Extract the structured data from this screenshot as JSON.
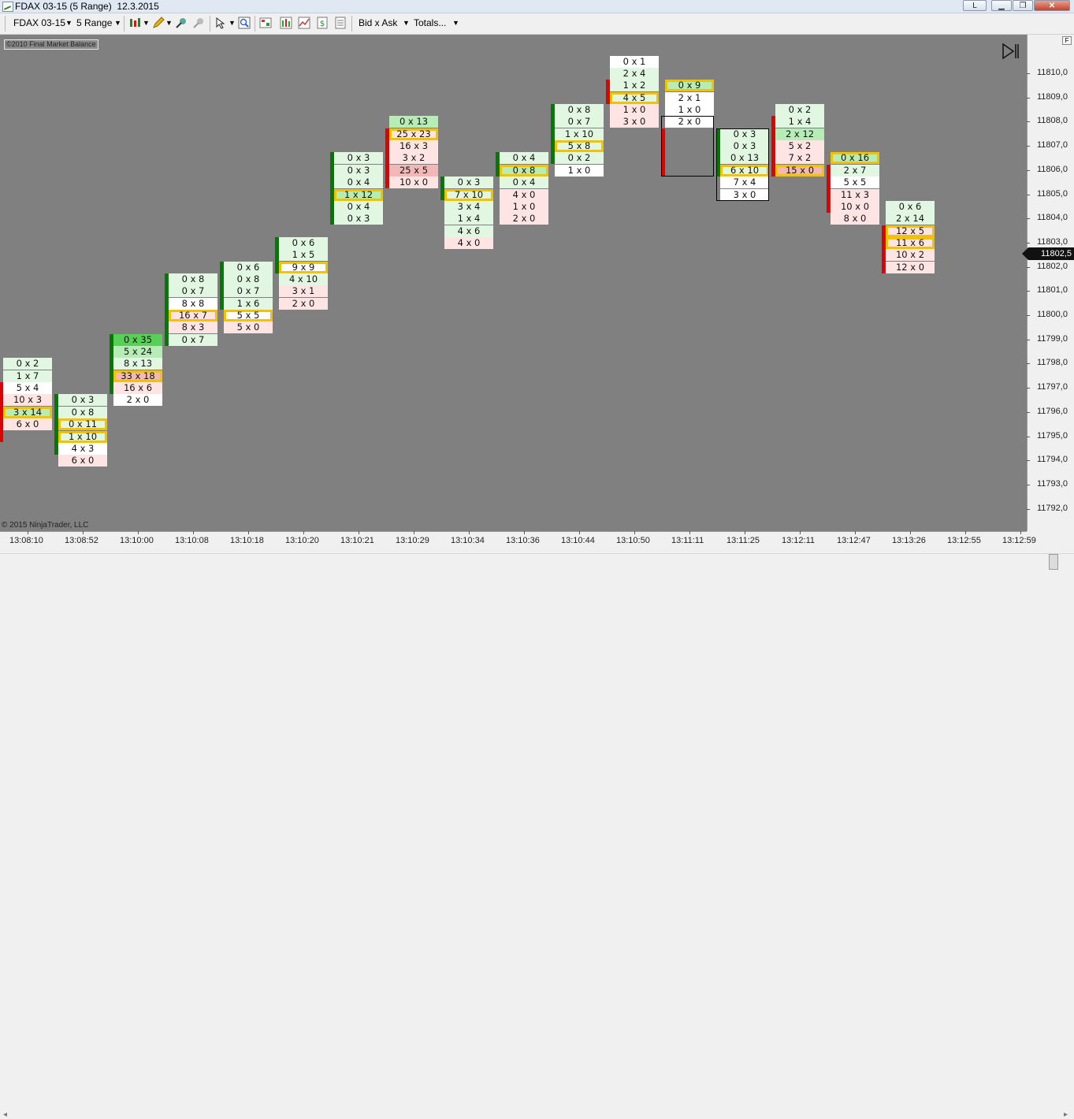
{
  "window": {
    "title": "FDAX 03-15 (5 Range)  12.3.2015",
    "controls": {
      "restore_label": "L",
      "minimize_label": "▁",
      "maximize_label": "❐",
      "close_label": "✕"
    }
  },
  "toolbar": {
    "instrument": "FDAX 03-15",
    "period": "5 Range",
    "bid_ask": "Bid x Ask",
    "totals": "Totals..."
  },
  "chart": {
    "badge": "©2010 Final Market Balance",
    "copyright": "© 2015 NinjaTrader, LLC",
    "last_price": "11802,5",
    "colors": {
      "background": "#808080",
      "up_bar": "#007a00",
      "down_bar": "#e00000",
      "highlight_border": "#f2c200",
      "bid_color": "#ffe4e4",
      "ask_color": "#e2f7e2"
    },
    "panel_button": "F"
  },
  "y_axis": {
    "labels": [
      "11810,0",
      "11809,0",
      "11808,0",
      "11807,0",
      "11806,0",
      "11805,0",
      "11804,0",
      "11803,0",
      "11802,0",
      "11801,0",
      "11800,0",
      "11799,0",
      "11798,0",
      "11797,0",
      "11796,0",
      "11795,0",
      "11794,0",
      "11793,0",
      "11792,0"
    ]
  },
  "x_axis": {
    "labels": [
      "13:08:10",
      "13:08:52",
      "13:10:00",
      "13:10:08",
      "13:10:18",
      "13:10:20",
      "13:10:21",
      "13:10:29",
      "13:10:34",
      "13:10:36",
      "13:10:44",
      "13:10:50",
      "13:11:11",
      "13:11:25",
      "13:12:11",
      "13:12:47",
      "13:13:26",
      "13:12:55",
      "13:12:59"
    ]
  },
  "bars": [
    {
      "top_price": 11798.0,
      "dir": "down",
      "body": [
        11797.0,
        11795.0
      ],
      "cells": [
        {
          "t": "0 x 2",
          "c": "ask1"
        },
        {
          "t": "1 x 7",
          "c": "ask1"
        },
        {
          "t": "5 x 4",
          "c": "neu"
        },
        {
          "t": "10 x 3",
          "c": "bid1"
        },
        {
          "t": "3 x 14",
          "c": "ask2",
          "hl": true
        },
        {
          "t": "6 x 0",
          "c": "bid1"
        }
      ]
    },
    {
      "top_price": 11796.5,
      "dir": "up",
      "body": [
        11796.5,
        11794.5
      ],
      "cells": [
        {
          "t": "0 x 3",
          "c": "ask1"
        },
        {
          "t": "0 x 8",
          "c": "ask1"
        },
        {
          "t": "0 x 11",
          "c": "ask1",
          "hl": true
        },
        {
          "t": "1 x 10",
          "c": "ask1",
          "hl": true
        },
        {
          "t": "4 x 3",
          "c": "neu"
        },
        {
          "t": "6 x 0",
          "c": "bid1"
        }
      ]
    },
    {
      "top_price": 11799.0,
      "dir": "up",
      "body": [
        11799.0,
        11797.0
      ],
      "cells": [
        {
          "t": "0 x 35",
          "c": "ask3"
        },
        {
          "t": "5 x 24",
          "c": "ask2"
        },
        {
          "t": "8 x 13",
          "c": "ask1"
        },
        {
          "t": "33 x 18",
          "c": "bid2",
          "hl": true
        },
        {
          "t": "16 x 6",
          "c": "bid1"
        },
        {
          "t": "2 x 0",
          "c": "neu"
        }
      ]
    },
    {
      "top_price": 11801.5,
      "dir": "up",
      "body": [
        11801.5,
        11799.0
      ],
      "cells": [
        {
          "t": "0 x 8",
          "c": "ask1"
        },
        {
          "t": "0 x 7",
          "c": "ask1"
        },
        {
          "t": "8 x 8",
          "c": "neu"
        },
        {
          "t": "16 x 7",
          "c": "bid1",
          "hl": true
        },
        {
          "t": "8 x 3",
          "c": "bid1"
        },
        {
          "t": "0 x 7",
          "c": "ask1"
        }
      ]
    },
    {
      "top_price": 11802.0,
      "dir": "up",
      "body": [
        11802.0,
        11800.5
      ],
      "cells": [
        {
          "t": "0 x 6",
          "c": "ask1"
        },
        {
          "t": "0 x 8",
          "c": "ask1"
        },
        {
          "t": "0 x 7",
          "c": "ask1"
        },
        {
          "t": "1 x 6",
          "c": "ask1"
        },
        {
          "t": "5 x 5",
          "c": "neu",
          "hl": true
        },
        {
          "t": "5 x 0",
          "c": "bid1"
        }
      ]
    },
    {
      "top_price": 11803.0,
      "dir": "up",
      "body": [
        11803.0,
        11802.0
      ],
      "cells": [
        {
          "t": "0 x 6",
          "c": "ask1"
        },
        {
          "t": "1 x 5",
          "c": "ask1"
        },
        {
          "t": "9 x 9",
          "c": "neu",
          "hl": true
        },
        {
          "t": "4 x 10",
          "c": "ask1"
        },
        {
          "t": "3 x 1",
          "c": "bid1"
        },
        {
          "t": "2 x 0",
          "c": "bid1"
        }
      ]
    },
    {
      "top_price": 11806.5,
      "dir": "up",
      "body": [
        11806.5,
        11804.0
      ],
      "cells": [
        {
          "t": "0 x 3",
          "c": "ask1"
        },
        {
          "t": "0 x 3",
          "c": "ask1"
        },
        {
          "t": "0 x 4",
          "c": "ask1"
        },
        {
          "t": "1 x 12",
          "c": "ask2",
          "hl": true
        },
        {
          "t": "0 x 4",
          "c": "ask1"
        },
        {
          "t": "0 x 3",
          "c": "ask1"
        }
      ]
    },
    {
      "top_price": 11808.0,
      "dir": "down",
      "body": [
        11807.5,
        11805.5
      ],
      "cells": [
        {
          "t": "0 x 13",
          "c": "ask2"
        },
        {
          "t": "25 x 23",
          "c": "bid1",
          "hl": true
        },
        {
          "t": "16 x 3",
          "c": "bid1"
        },
        {
          "t": "3 x 2",
          "c": "bid1"
        },
        {
          "t": "25 x 5",
          "c": "bid2"
        },
        {
          "t": "10 x 0",
          "c": "bid1"
        }
      ]
    },
    {
      "top_price": 11805.5,
      "dir": "up",
      "body": [
        11805.5,
        11805.0
      ],
      "cells": [
        {
          "t": "0 x 3",
          "c": "ask1"
        },
        {
          "t": "7 x 10",
          "c": "ask1",
          "hl": true
        },
        {
          "t": "3 x 4",
          "c": "ask1"
        },
        {
          "t": "1 x 4",
          "c": "ask1"
        },
        {
          "t": "4 x 6",
          "c": "ask1"
        },
        {
          "t": "4 x 0",
          "c": "bid1"
        }
      ]
    },
    {
      "top_price": 11806.5,
      "dir": "up",
      "body": [
        11806.5,
        11806.0
      ],
      "cells": [
        {
          "t": "0 x 4",
          "c": "ask1"
        },
        {
          "t": "0 x 8",
          "c": "ask2",
          "hl": true
        },
        {
          "t": "0 x 4",
          "c": "ask1"
        },
        {
          "t": "4 x 0",
          "c": "bid1"
        },
        {
          "t": "1 x 0",
          "c": "bid1"
        },
        {
          "t": "2 x 0",
          "c": "bid1"
        }
      ]
    },
    {
      "top_price": 11808.5,
      "dir": "up",
      "body": [
        11808.5,
        11806.5
      ],
      "cells": [
        {
          "t": "0 x 8",
          "c": "ask1"
        },
        {
          "t": "0 x 7",
          "c": "ask1"
        },
        {
          "t": "1 x 10",
          "c": "ask1"
        },
        {
          "t": "5 x 8",
          "c": "ask1",
          "hl": true
        },
        {
          "t": "0 x 2",
          "c": "ask1"
        },
        {
          "t": "1 x 0",
          "c": "neu"
        }
      ]
    },
    {
      "top_price": 11810.5,
      "dir": "down",
      "body": [
        11809.5,
        11809.0
      ],
      "cells": [
        {
          "t": "0 x 1",
          "c": "neu"
        },
        {
          "t": "2 x 4",
          "c": "ask1"
        },
        {
          "t": "1 x 2",
          "c": "ask1"
        },
        {
          "t": "4 x 5",
          "c": "ask1",
          "hl": true
        },
        {
          "t": "1 x 0",
          "c": "bid1"
        },
        {
          "t": "3 x 0",
          "c": "bid1"
        }
      ]
    },
    {
      "top_price": 11809.5,
      "dir": "down",
      "body": [
        11807.5,
        11806.0
      ],
      "cells": [
        {
          "t": "0 x 9",
          "c": "ask2",
          "hl": true
        },
        {
          "t": "2 x 1",
          "c": "neu"
        },
        {
          "t": "1 x 0",
          "c": "neu"
        },
        {
          "t": "2 x 0",
          "c": "neu"
        }
      ]
    },
    {
      "top_price": 11807.5,
      "dir": "up",
      "body": [
        11807.5,
        11806.0
      ],
      "cells": [
        {
          "t": "0 x 3",
          "c": "ask1"
        },
        {
          "t": "0 x 3",
          "c": "ask1"
        },
        {
          "t": "0 x 13",
          "c": "ask1"
        },
        {
          "t": "6 x 10",
          "c": "ask1",
          "hl": true
        },
        {
          "t": "7 x 4",
          "c": "neu"
        },
        {
          "t": "3 x 0",
          "c": "neu"
        }
      ]
    },
    {
      "top_price": 11808.5,
      "dir": "down",
      "body": [
        11808.0,
        11806.0
      ],
      "cells": [
        {
          "t": "0 x 2",
          "c": "ask1"
        },
        {
          "t": "1 x 4",
          "c": "ask1"
        },
        {
          "t": "2 x 12",
          "c": "ask2"
        },
        {
          "t": "5 x 2",
          "c": "bid1"
        },
        {
          "t": "7 x 2",
          "c": "bid1"
        },
        {
          "t": "15 x 0",
          "c": "bid2",
          "hl": true
        }
      ]
    },
    {
      "top_price": 11806.5,
      "dir": "down",
      "body": [
        11806.0,
        11804.5
      ],
      "cells": [
        {
          "t": "0 x 16",
          "c": "ask2",
          "hl": true
        },
        {
          "t": "2 x 7",
          "c": "ask1"
        },
        {
          "t": "5 x 5",
          "c": "neu"
        },
        {
          "t": "11 x 3",
          "c": "bid1"
        },
        {
          "t": "10 x 0",
          "c": "bid1"
        },
        {
          "t": "8 x 0",
          "c": "bid1"
        }
      ]
    },
    {
      "top_price": 11804.5,
      "dir": "down",
      "body": [
        11803.5,
        11802.0
      ],
      "cells": [
        {
          "t": "0 x 6",
          "c": "ask1"
        },
        {
          "t": "2 x 14",
          "c": "ask1"
        },
        {
          "t": "12 x 5",
          "c": "bid1",
          "hl": true
        },
        {
          "t": "11 x 6",
          "c": "bid1",
          "hl": true
        },
        {
          "t": "10 x 2",
          "c": "bid1"
        },
        {
          "t": "12 x 0",
          "c": "bid1"
        }
      ]
    }
  ]
}
